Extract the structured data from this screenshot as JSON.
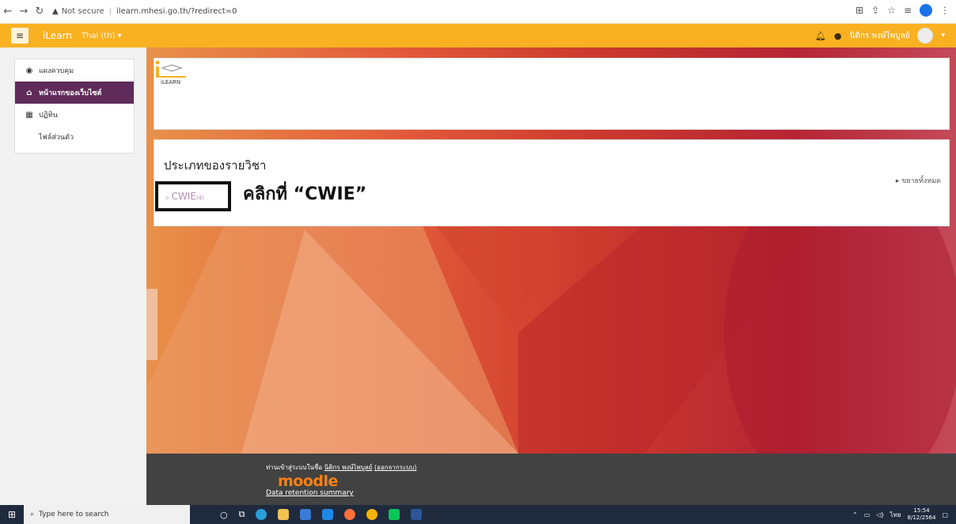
{
  "browser": {
    "warning": "Not secure",
    "url": "ilearn.mhesi.go.th/?redirect=0"
  },
  "navbar": {
    "site_name": "iLearn",
    "language": "Thai (th) ▾",
    "username": "นิติกร พงษ์ไพบูลย์"
  },
  "sidebar": {
    "items": [
      {
        "label": "แผงควบคุม",
        "icon": "dashboard-icon"
      },
      {
        "label": "หน้าแรกของเว็บไซต์",
        "icon": "home-icon",
        "active": true
      },
      {
        "label": "ปฏิทิน",
        "icon": "calendar-icon"
      },
      {
        "label": "ไฟล์ส่วนตัว",
        "icon": ""
      }
    ]
  },
  "header": {
    "logo_text": "iLEARN"
  },
  "courses": {
    "title": "ประเภทของรายวิชา",
    "expand_all": "ขยายทั้งหมด",
    "category": "CWIE",
    "category_count": "(4)",
    "annotation": "คลิกที่ “CWIE”"
  },
  "footer": {
    "login_prefix": "ท่านเข้าสู่ระบบในชื่อ",
    "login_name": "นิติกร พงษ์ไพบูลย์",
    "logout": "(ออกจากระบบ)",
    "logo": "moodle",
    "retention": "Data retention summary"
  },
  "taskbar": {
    "search_placeholder": "Type here to search",
    "lang": "ไทย",
    "time": "15:54",
    "date": "8/12/2564"
  },
  "colors": {
    "navbar": "#f9b122",
    "active_item": "#5e2b5a",
    "footer": "#424242"
  }
}
